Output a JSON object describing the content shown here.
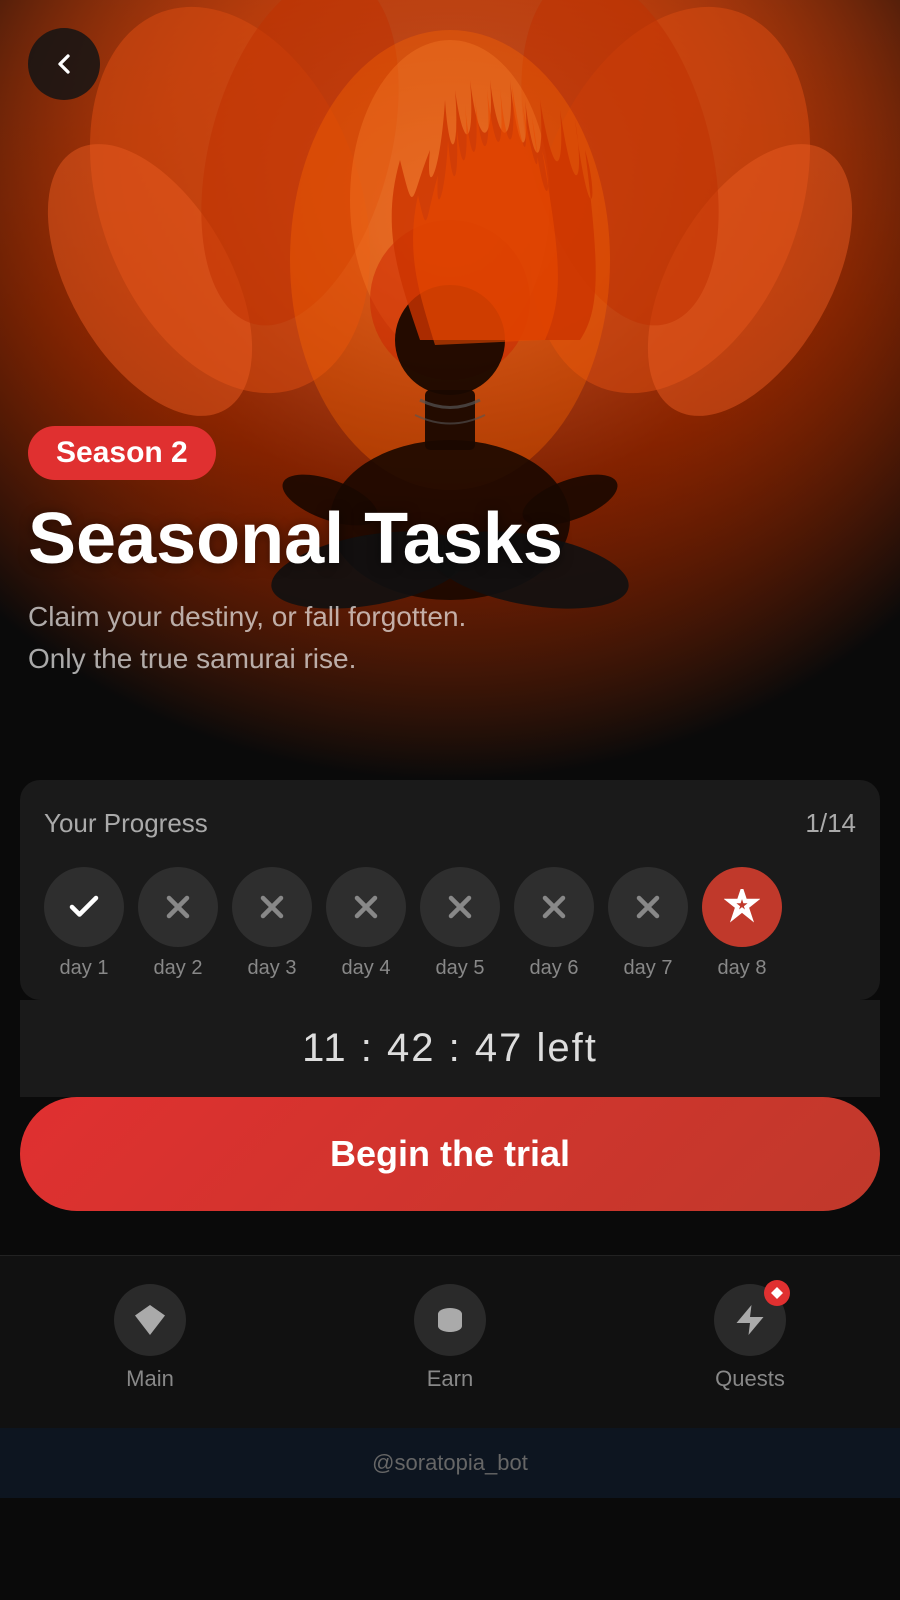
{
  "hero": {
    "season_badge": "Season 2",
    "title": "Seasonal Tasks",
    "subtitle_line1": "Claim your destiny, or fall forgotten.",
    "subtitle_line2": "Only the true samurai rise."
  },
  "progress": {
    "label": "Your Progress",
    "count": "1/14",
    "days": [
      {
        "id": "day1",
        "label": "day 1",
        "state": "completed"
      },
      {
        "id": "day2",
        "label": "day 2",
        "state": "incomplete"
      },
      {
        "id": "day3",
        "label": "day 3",
        "state": "incomplete"
      },
      {
        "id": "day4",
        "label": "day 4",
        "state": "incomplete"
      },
      {
        "id": "day5",
        "label": "day 5",
        "state": "incomplete"
      },
      {
        "id": "day6",
        "label": "day 6",
        "state": "incomplete"
      },
      {
        "id": "day7",
        "label": "day 7",
        "state": "incomplete"
      },
      {
        "id": "day8",
        "label": "day 8",
        "state": "partial"
      }
    ]
  },
  "timer": {
    "display": "11 : 42 : 47 left"
  },
  "cta": {
    "begin_label": "Begin the trial"
  },
  "nav": {
    "items": [
      {
        "id": "main",
        "label": "Main",
        "icon": "diamond-icon"
      },
      {
        "id": "earn",
        "label": "Earn",
        "icon": "coins-icon"
      },
      {
        "id": "quests",
        "label": "Quests",
        "icon": "lightning-icon",
        "badge": true
      }
    ]
  },
  "footer": {
    "text": "@soratopia_bot"
  }
}
